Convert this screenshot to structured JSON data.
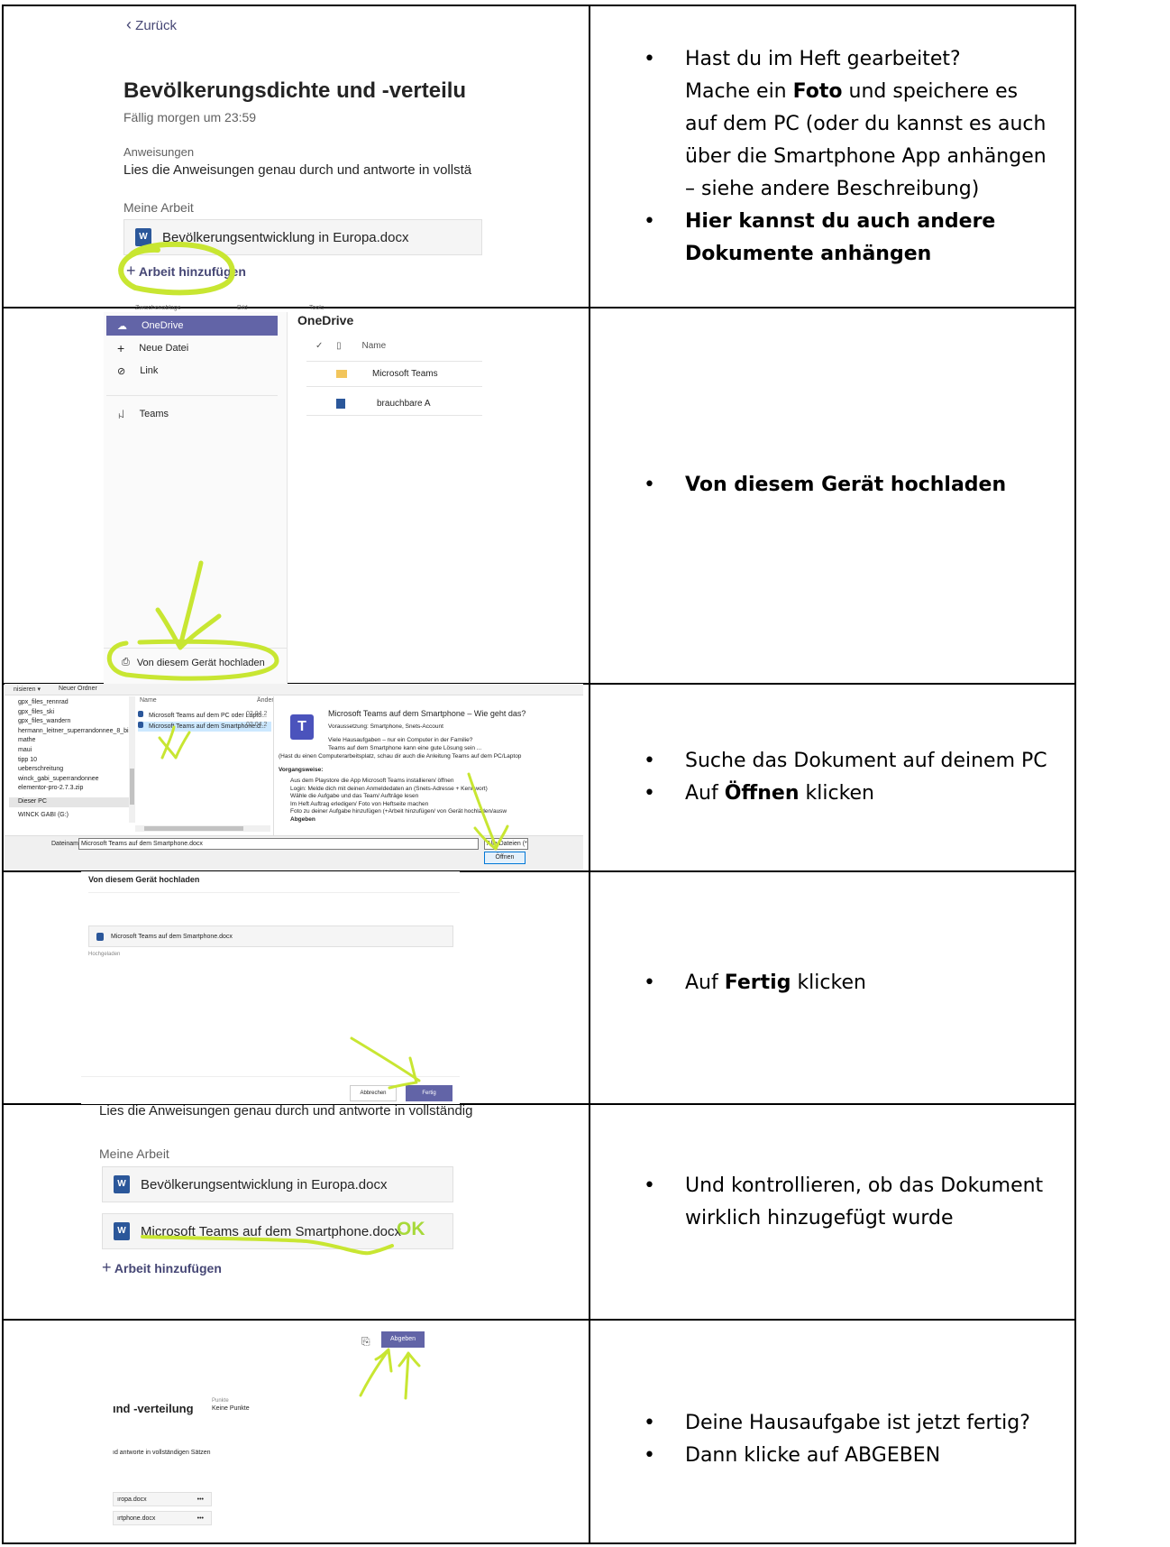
{
  "row1": {
    "back_label": "Zurück",
    "title": "Bevölkerungsdichte und -verteilu",
    "due": "Fällig morgen um 23:59",
    "instructions_heading": "Anweisungen",
    "instructions_text": "Lies die Anweisungen genau durch und antworte in vollstä",
    "my_work_heading": "Meine Arbeit",
    "file_name": "Bevölkerungsentwicklung in Europa.docx",
    "add_work": "Arbeit hinzufügen",
    "bullets": [
      {
        "pre": "Hast du im Heft gearbeitet?",
        "line2_a": "Mache ein ",
        "line2_b": "Foto",
        "line2_c": " und speichere es auf dem PC (oder du kannst es auch über die Smartphone App anhängen – siehe andere Beschreibung)"
      },
      {
        "bold": "Hier kannst du auch andere Dokumente anhängen"
      }
    ]
  },
  "row2": {
    "ribbon": [
      "Zwischenablage",
      "Bild",
      "Tools"
    ],
    "menu": [
      {
        "label": "OneDrive",
        "icon": "cloud-icon"
      },
      {
        "label": "Neue Datei",
        "icon": "plus-icon"
      },
      {
        "label": "Link",
        "icon": "link-icon"
      },
      {
        "label": "Teams",
        "icon": "teams-icon"
      }
    ],
    "pane_title": "OneDrive",
    "col_name": "Name",
    "files": [
      "Microsoft Teams",
      "brauchbare A"
    ],
    "upload_label": "Von diesem Gerät hochladen",
    "bullet_bold": "Von diesem Gerät hochladen"
  },
  "row3": {
    "toolbar": [
      "nisieren ▾",
      "Neuer Ordner"
    ],
    "folders": [
      "gpx_files_rennrad",
      "gpx_files_ski",
      "gpx_files_wandern",
      "hermann_leitner_superrandonnee_8_bis_10",
      "mathe",
      "maui",
      "tipp 10",
      "ueberschreitung",
      "winck_gabi_superrandonnee",
      "elementor-pro-2.7.3.zip",
      "Dieser PC",
      "WINCK GABI (G:)"
    ],
    "col_name": "Name",
    "col_changed": "Änder",
    "files": [
      {
        "name": "Microsoft Teams auf dem PC oder Lapto...",
        "date": "02.04.2"
      },
      {
        "name": "Microsoft Teams auf dem Smartphone.d...",
        "date": "02.04.2"
      }
    ],
    "preview_title": "Microsoft Teams auf dem Smartphone – Wie geht das?",
    "preview_lines": [
      "Voraussetzung: Smartphone, Snets-Account",
      "Viele Hausaufgaben – nur ein Computer in der Familie?",
      "Teams auf dem Smartphone kann eine gute Lösung sein ...",
      "(Hast du einen Computerarbeitsplatz, schau dir auch die Anleitung Teams auf dem PC/Laptop",
      "Vorgangsweise:",
      "Aus dem Playstore die App Microsoft Teams installieren/ öffnen",
      "Login: Melde dich mit deinen Anmeldedaten an (Snets-Adresse + Kennwort)",
      "Wähle die Aufgabe und das Team/ Aufträge lesen",
      "Im Heft Auftrag erledigen/ Foto von Heftseite machen",
      "Foto zu deiner Aufgabe hinzufügen (+Arbeit hinzufügen/ von Gerät hochladen/ausw",
      "Abgeben"
    ],
    "filename_label": "Dateiname:",
    "filename_value": "Microsoft Teams auf dem Smartphone.docx",
    "filter": "Alle Dateien (*.*",
    "open_button": "Öffnen",
    "bullet1": "Suche das Dokument auf deinem PC",
    "bullet2_a": "Auf ",
    "bullet2_b": "Öffnen",
    "bullet2_c": " klicken"
  },
  "row4": {
    "title": "Von diesem Gerät hochladen",
    "file_name": "Microsoft Teams auf dem Smartphone.docx",
    "status": "Hochgeladen",
    "cancel": "Abbrechen",
    "done": "Fertig",
    "bullet_a": "Auf ",
    "bullet_b": "Fertig",
    "bullet_c": " klicken"
  },
  "row5": {
    "instructions_text": "Lies die Anweisungen genau durch und antworte in vollständig",
    "my_work_heading": "Meine Arbeit",
    "file1": "Bevölkerungsentwicklung in Europa.docx",
    "file2": "Microsoft Teams auf dem Smartphone.docx",
    "ok": "OK",
    "add_work": "Arbeit hinzufügen",
    "bullet": "Und kontrollieren, ob das Dokument wirklich hinzugefügt wurde"
  },
  "row6": {
    "submit": "Abgeben",
    "title": "ınd -verteilung",
    "points_label": "Punkte",
    "points_value": "Keine Punkte",
    "instructions": "ıd antworte in vollständigen Sätzen",
    "files": [
      "ıropa.docx",
      "ırtphone.docx"
    ],
    "more": "•••",
    "bullet1": "Deine Hausaufgabe ist jetzt fertig?",
    "bullet2": "Dann klicke auf ABGEBEN"
  }
}
